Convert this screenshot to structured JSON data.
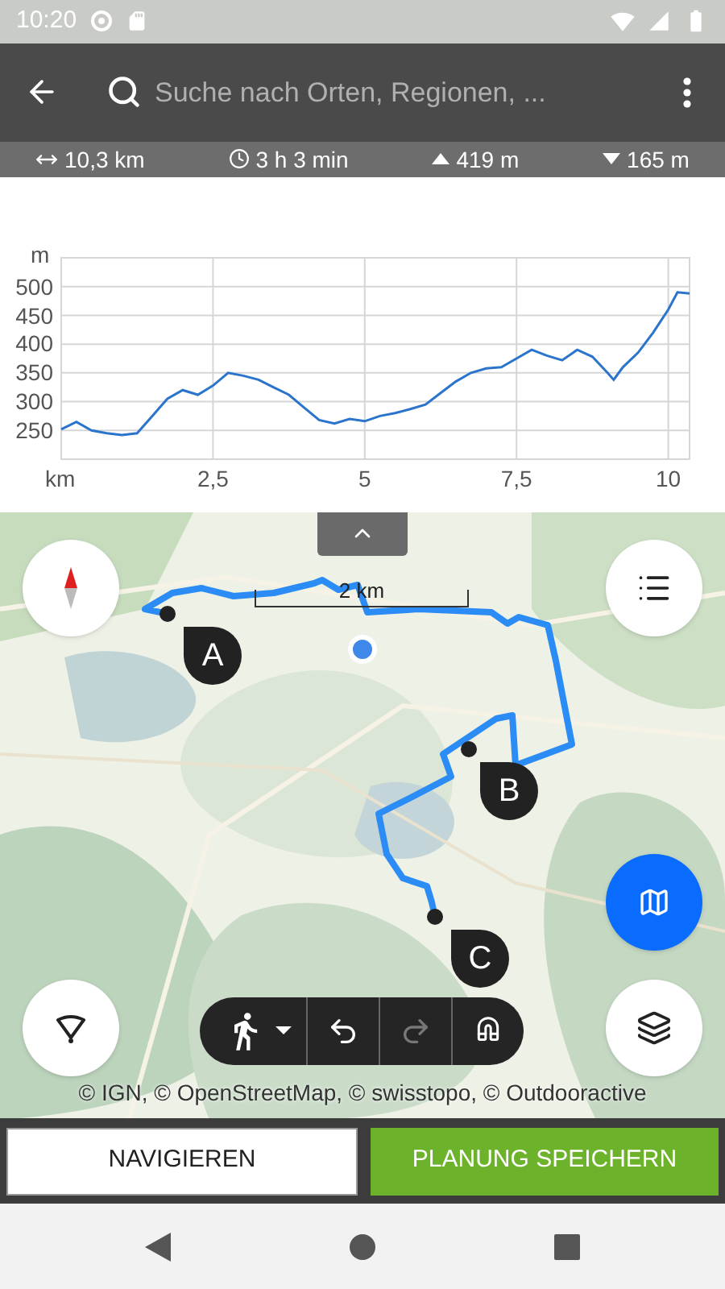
{
  "status_bar": {
    "time": "10:20"
  },
  "search": {
    "placeholder": "Suche nach Orten, Regionen, ..."
  },
  "stats": [
    {
      "kind": "distance",
      "text": "10,3 km"
    },
    {
      "kind": "duration",
      "text": "3 h 3 min"
    },
    {
      "kind": "ascent",
      "text": "419 m"
    },
    {
      "kind": "descent",
      "text": "165 m"
    }
  ],
  "elevation_profile": {
    "chart_data": {
      "type": "line",
      "grid": true,
      "xlabel": "km",
      "ylabel": "m",
      "xlim": [
        0,
        10.35
      ],
      "ylim": [
        200,
        550
      ],
      "xticks": [
        {
          "value": 2.5,
          "label": "2,5"
        },
        5,
        {
          "value": 7.5,
          "label": "7,5"
        },
        10
      ],
      "yticks": [
        250,
        300,
        350,
        400,
        450,
        500
      ],
      "x": [
        0,
        0.25,
        0.5,
        0.75,
        1,
        1.25,
        1.5,
        1.75,
        2,
        2.25,
        2.5,
        2.75,
        3,
        3.25,
        3.5,
        3.75,
        4,
        4.25,
        4.5,
        4.75,
        5,
        5.25,
        5.5,
        5.75,
        6,
        6.25,
        6.5,
        6.75,
        7,
        7.25,
        7.5,
        7.75,
        8,
        8.25,
        8.5,
        8.75,
        9,
        9.1,
        9.25,
        9.5,
        9.75,
        10,
        10.15,
        10.35
      ],
      "series": [
        {
          "color": "#2a74cc",
          "values": [
            252,
            265,
            250,
            245,
            242,
            245,
            275,
            305,
            320,
            312,
            328,
            350,
            345,
            338,
            325,
            312,
            290,
            268,
            262,
            270,
            266,
            275,
            280,
            287,
            295,
            315,
            335,
            350,
            358,
            360,
            375,
            390,
            380,
            372,
            390,
            378,
            350,
            338,
            360,
            385,
            420,
            460,
            490,
            488
          ]
        }
      ]
    }
  },
  "map": {
    "scale": "2 km",
    "markers": [
      {
        "label": "A"
      },
      {
        "label": "B"
      },
      {
        "label": "C"
      }
    ],
    "toolbar": [
      {
        "kind": "walk",
        "disabled": false
      },
      {
        "kind": "undo",
        "disabled": false
      },
      {
        "kind": "redo",
        "disabled": true
      },
      {
        "kind": "magnet",
        "disabled": false
      }
    ],
    "attribution": "© IGN, © OpenStreetMap, © swisstopo, © Outdooractive"
  },
  "buttons": [
    {
      "label": "NAVIGIEREN",
      "kind": "outline"
    },
    {
      "label": "PLANUNG SPEICHERN",
      "kind": "primary"
    }
  ]
}
